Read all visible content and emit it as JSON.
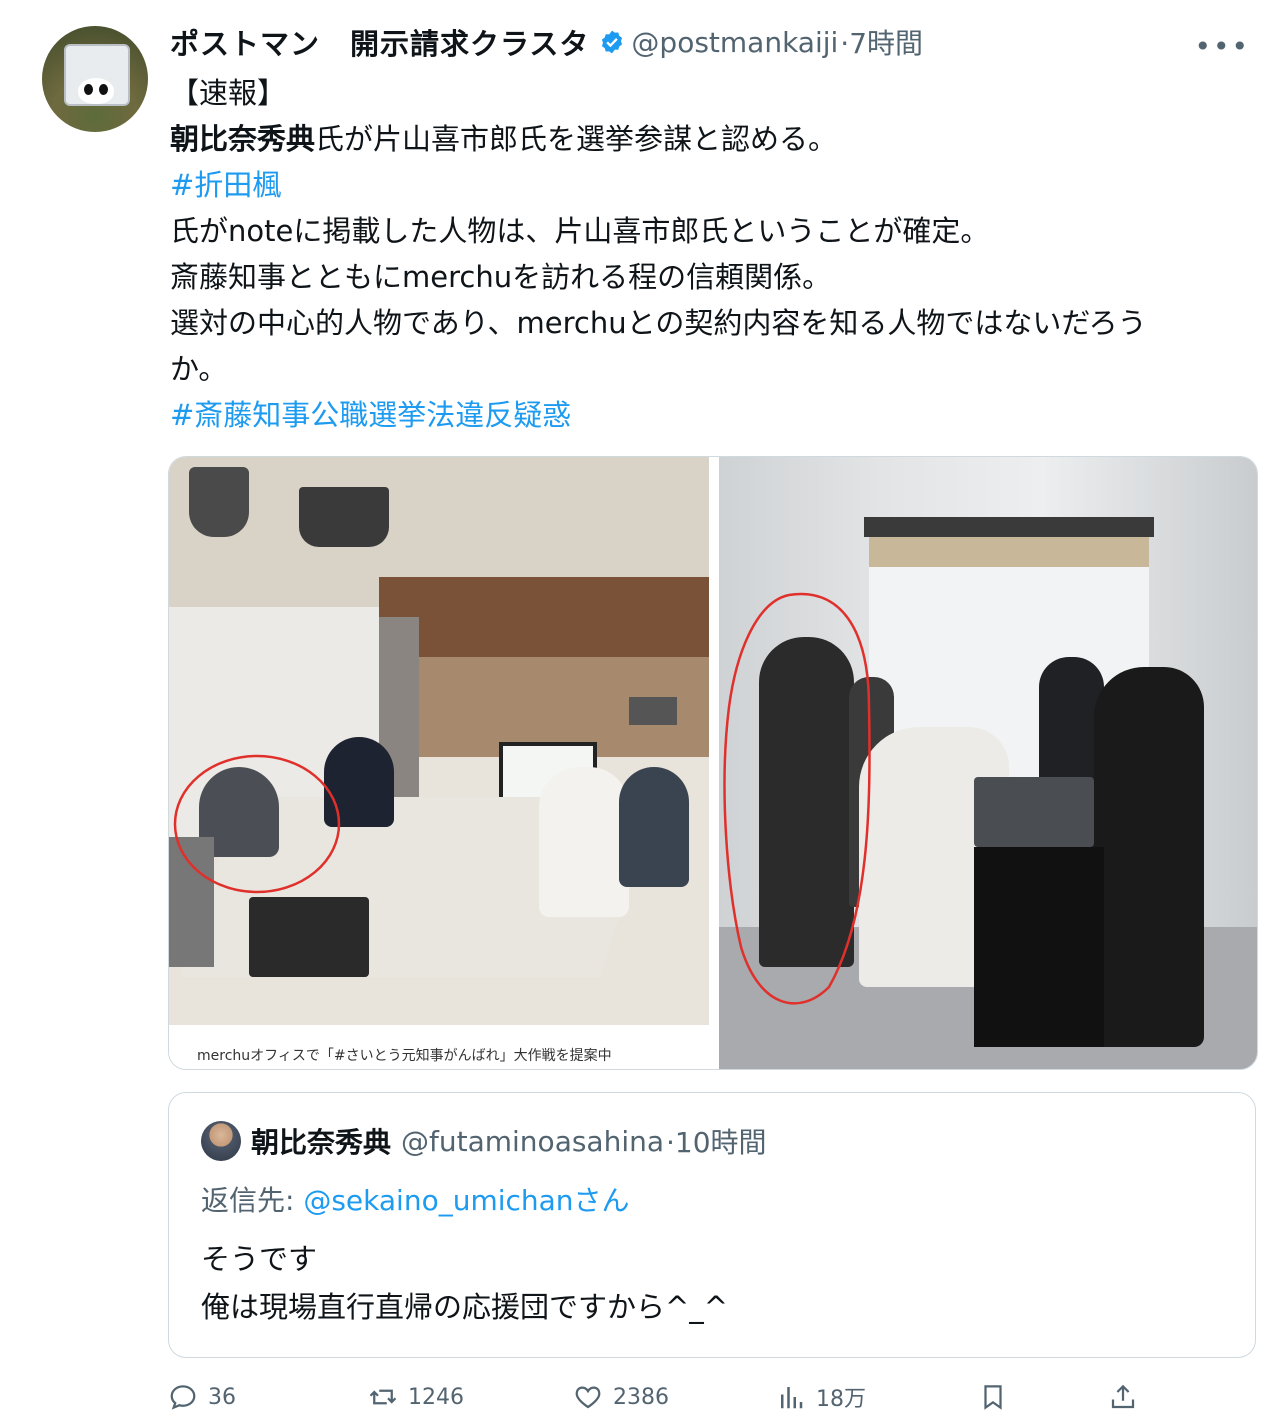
{
  "post": {
    "author_name": "ポストマン　開示請求クラスタ",
    "handle": "@postmankaiji",
    "time": "·7時間",
    "more_icon": "more-icon",
    "text": {
      "line1": "【速報】",
      "line2_bold": "朝比奈秀典",
      "line2_rest": "氏が片山喜市郎氏を選挙参謀と認める。",
      "hashtag1": "#折田楓",
      "line4": "氏がnoteに掲載した人物は、片山喜市郎氏ということが確定。",
      "line5": "斎藤知事とともにmerchuを訪れる程の信頼関係。",
      "line6": "選対の中心的人物であり、merchuとの契約内容を知る人物ではないだろう",
      "line7": "か。",
      "hashtag2": "#斎藤知事公職選挙法違反疑惑"
    },
    "image_caption": "merchuオフィスで「#さいとう元知事がんばれ」大作戦を提案中"
  },
  "quote": {
    "author_name": "朝比奈秀典",
    "handle": "@futaminoasahina",
    "time": "·10時間",
    "reply_prefix": "返信先: ",
    "reply_to": "@sekaino_umichan",
    "reply_suffix": "さん",
    "line1": "そうです",
    "line2": "俺は現場直行直帰の応援団ですから^_^"
  },
  "actions": {
    "replies": "36",
    "reposts": "1246",
    "likes": "2386",
    "views": "18万"
  },
  "colors": {
    "accent": "#1d9bf0",
    "muted": "#536471",
    "text": "#0f1419",
    "border": "#cfd9de",
    "annotation_circle": "#e0302c"
  }
}
